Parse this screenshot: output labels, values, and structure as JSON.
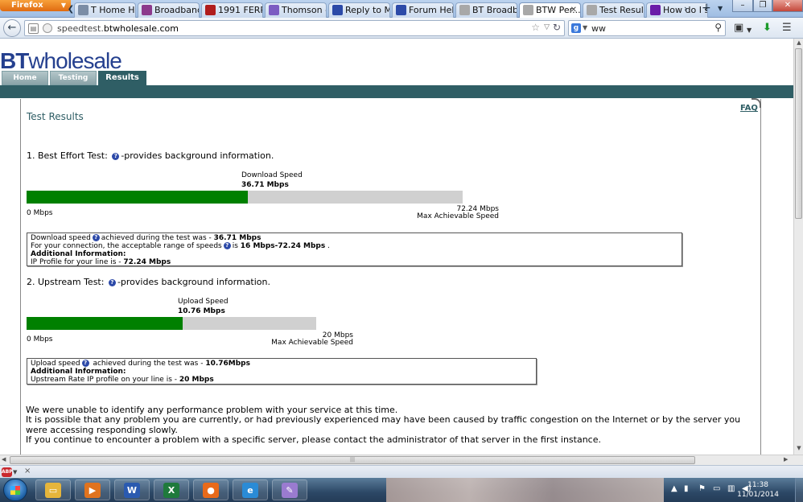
{
  "browser": {
    "app_button": "Firefox",
    "tabs": [
      {
        "label": "T Home H...",
        "fav_color": "#7b8da6"
      },
      {
        "label": "Broadband ...",
        "fav_color": "#8c3a8c"
      },
      {
        "label": "1991 FERRA...",
        "fav_color": "#b01c1c"
      },
      {
        "label": "Thomson - ...",
        "fav_color": "#7c5cc2"
      },
      {
        "label": "Reply to Me...",
        "fav_color": "#2c4aa8"
      },
      {
        "label": "Forum Help...",
        "fav_color": "#2c4aa8"
      },
      {
        "label": "BT Broadba...",
        "fav_color": "#a8a8a8"
      },
      {
        "label": "BTW Per...",
        "fav_color": "#a8a8a8"
      },
      {
        "label": "Test Result",
        "fav_color": "#a8a8a8"
      },
      {
        "label": "How do I sa...",
        "fav_color": "#6a1ca8"
      }
    ],
    "url_prefix": "speedtest.",
    "url_domain": "btwholesale.com",
    "search_value": "ww",
    "search_engine_icon": "google-icon"
  },
  "site": {
    "logo_bold": "BT",
    "logo_rest": "wholesale",
    "nav": [
      "Home",
      "Testing",
      "Results"
    ],
    "faq": "FAQ",
    "title": "Test Results",
    "accent": "#2f5e65"
  },
  "download": {
    "heading_pre": "1. Best Effort Test:",
    "heading_post": "-provides background information.",
    "bar_label": "Download Speed",
    "value_text": "36.71 Mbps",
    "value": 36.71,
    "max": 72.24,
    "min_label": "0 Mbps",
    "max_label": "72.24 Mbps",
    "max_caption": "Max Achievable Speed",
    "info": {
      "l1_a": "Download speed",
      "l1_b": "achieved during the test was - ",
      "l1_val": "36.71 Mbps",
      "l2_a": "For your connection, the acceptable range of speeds",
      "l2_b": "is ",
      "l2_val": "16 Mbps-72.24 Mbps",
      "l2_end": " .",
      "l3": "Additional Information:",
      "l4_a": "IP Profile for your line is - ",
      "l4_val": "72.24 Mbps"
    }
  },
  "upload": {
    "heading_pre": "2. Upstream Test:",
    "heading_post": "-provides background information.",
    "bar_label": "Upload Speed",
    "value_text": "10.76 Mbps",
    "value": 10.76,
    "max": 20,
    "min_label": "0 Mbps",
    "max_label": "20 Mbps",
    "max_caption": "Max Achievable Speed",
    "info": {
      "l1_a": "Upload speed",
      "l1_b": " achieved during the test was - ",
      "l1_val": "10.76Mbps",
      "l2": "Additional Information:",
      "l3_a": "Upstream Rate IP profile on your line is - ",
      "l3_val": "20 Mbps"
    }
  },
  "message": {
    "p1": "We were unable to identify any performance problem with your service at this time.",
    "p2": "It is possible that any problem you are currently, or had previously experienced may have been caused by traffic congestion on the Internet or by the server you were accessing responding slowly.",
    "p3": "If you continue to encounter a problem with a specific server, please contact the administrator of that server in the first instance."
  },
  "addon": {
    "abp_label": "ABP"
  },
  "taskbar": {
    "apps": [
      {
        "name": "explorer",
        "icon": "folder-icon",
        "color": "#e6b53b",
        "glyph": "▭"
      },
      {
        "name": "media",
        "icon": "media-player-icon",
        "color": "#e0731e",
        "glyph": "▶"
      },
      {
        "name": "word",
        "icon": "word-icon",
        "color": "#2a5ab0",
        "glyph": "W"
      },
      {
        "name": "excel",
        "icon": "excel-icon",
        "color": "#1f7a3c",
        "glyph": "X"
      },
      {
        "name": "firefox",
        "icon": "firefox-icon",
        "color": "#e86a1a",
        "glyph": "●"
      },
      {
        "name": "ie",
        "icon": "internet-explorer-icon",
        "color": "#2a8bd6",
        "glyph": "e"
      },
      {
        "name": "paint",
        "icon": "paint-icon",
        "color": "#9a7bd0",
        "glyph": "✎"
      }
    ],
    "time": "11:38",
    "date": "11/01/2014"
  }
}
